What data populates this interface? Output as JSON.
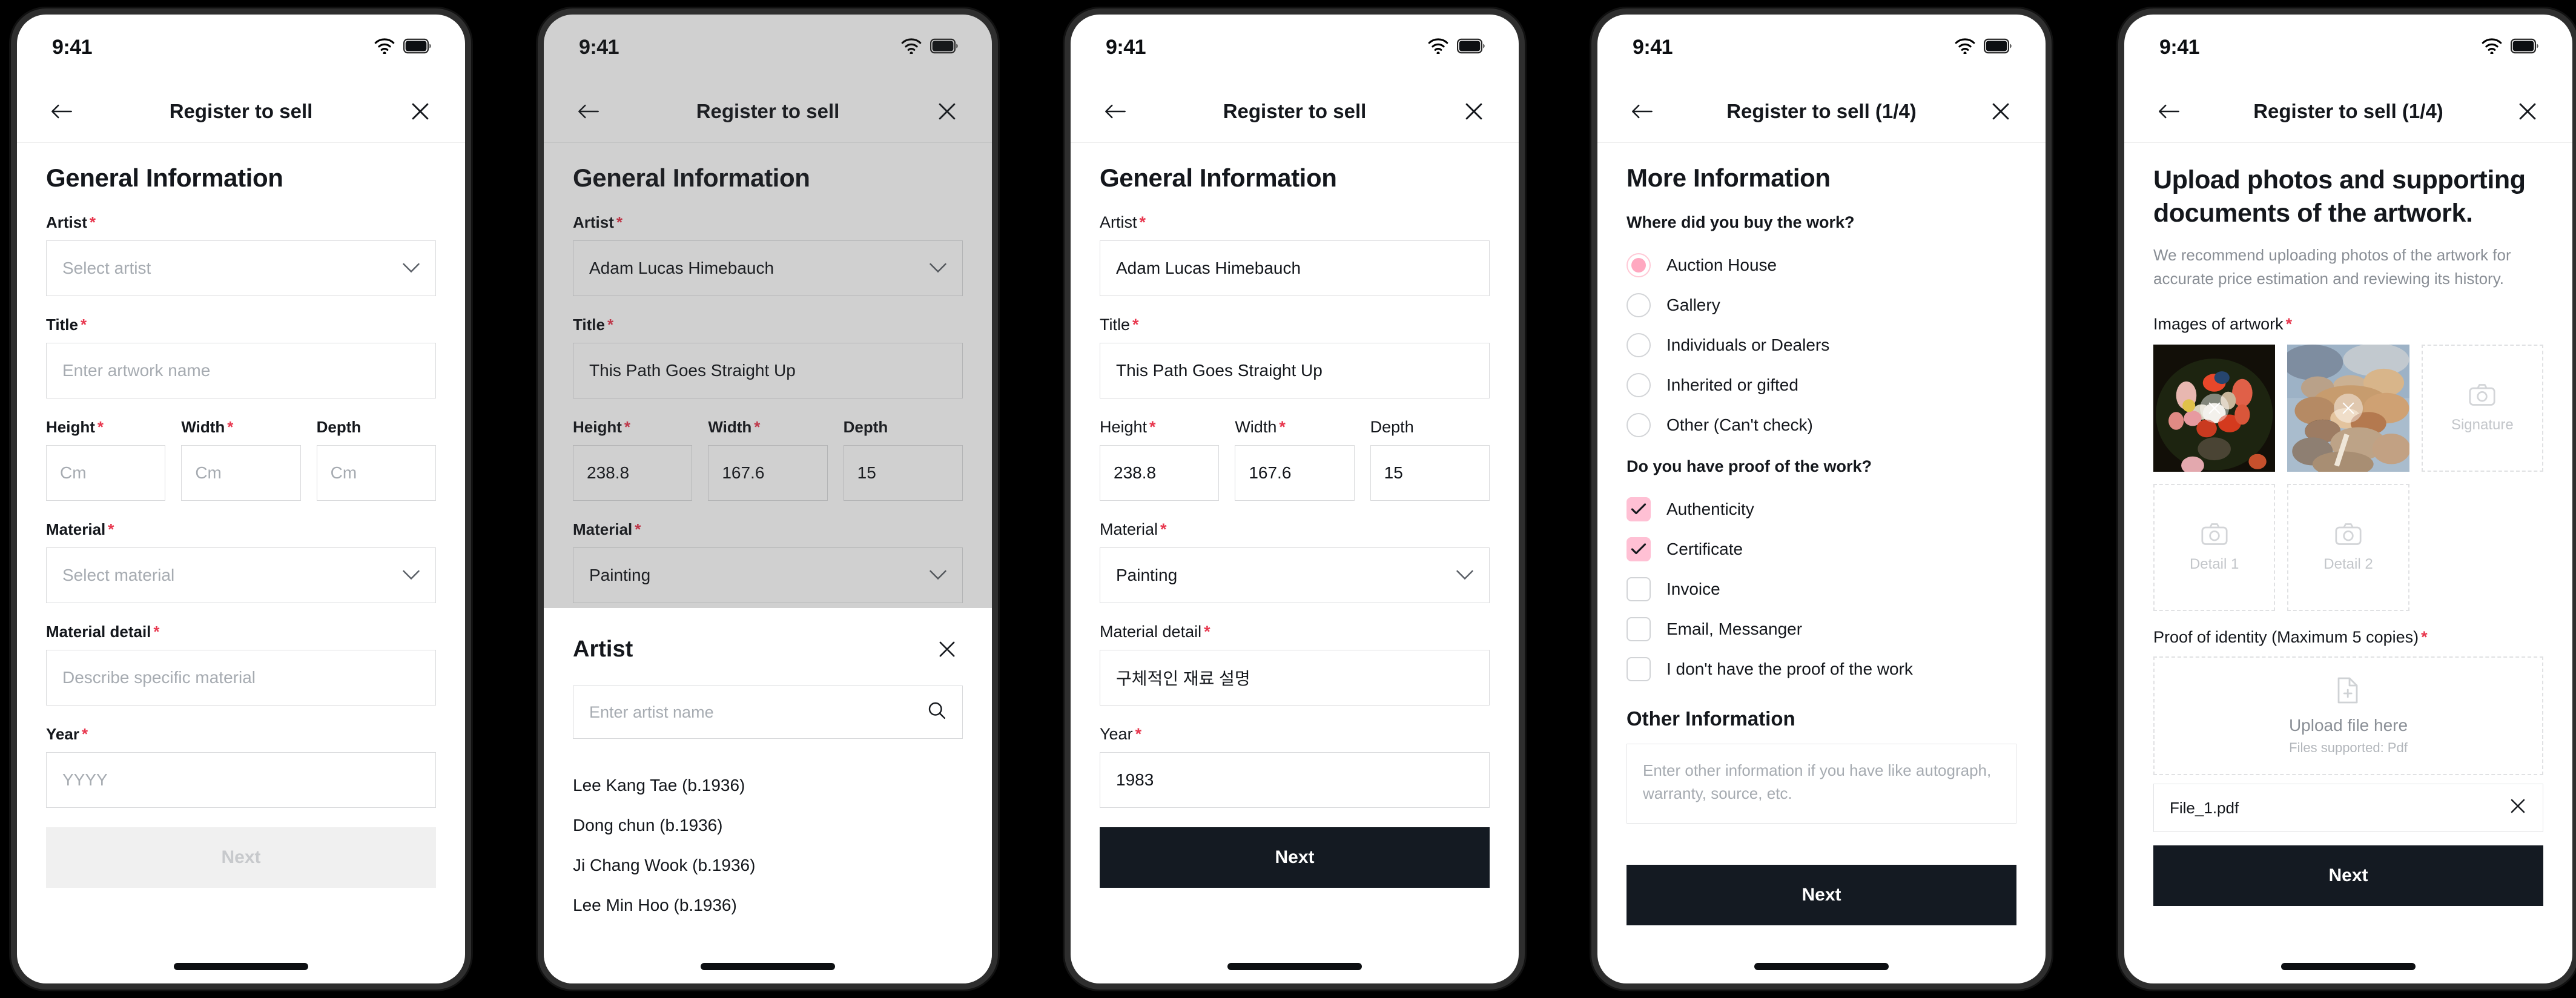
{
  "status": {
    "time": "9:41",
    "wifi_icon": "wifi-icon",
    "battery_icon": "battery-icon"
  },
  "nav": {
    "title_plain": "Register to sell",
    "title_step": "Register to sell (1/4)",
    "back_icon": "arrow-left-icon",
    "close_icon": "close-icon"
  },
  "screen1": {
    "page_title": "General Information",
    "fields": {
      "artist_label": "Artist",
      "artist_placeholder": "Select artist",
      "title_label": "Title",
      "title_placeholder": "Enter artwork name",
      "height_label": "Height",
      "height_placeholder": "Cm",
      "width_label": "Width",
      "width_placeholder": "Cm",
      "depth_label": "Depth",
      "depth_placeholder": "Cm",
      "material_label": "Material",
      "material_placeholder": "Select material",
      "material_detail_label": "Material detail",
      "material_detail_placeholder": "Describe specific material",
      "year_label": "Year",
      "year_placeholder": "YYYY"
    },
    "next_label": "Next"
  },
  "screen2": {
    "page_title": "General Information",
    "values": {
      "artist": "Adam Lucas Himebauch",
      "title": "This Path Goes Straight Up",
      "height": "238.8",
      "width": "167.6",
      "depth": "15",
      "material": "Painting"
    },
    "sheet": {
      "title": "Artist",
      "close_icon": "close-icon",
      "search_placeholder": "Enter artist name",
      "search_icon": "search-icon",
      "items": [
        "Lee Kang Tae (b.1936)",
        "Dong chun (b.1936)",
        "Ji Chang Wook (b.1936)",
        "Lee Min Hoo (b.1936)"
      ]
    }
  },
  "screen3": {
    "page_title": "General Information",
    "values": {
      "artist": "Adam Lucas Himebauch",
      "title": "This Path Goes Straight Up",
      "height": "238.8",
      "width": "167.6",
      "depth": "15",
      "material": "Painting",
      "material_detail": "구체적인 재료 설명",
      "year": "1983"
    },
    "next_label": "Next"
  },
  "screen4": {
    "page_title": "More Information",
    "question_where": "Where did you buy the work?",
    "where_options": [
      {
        "label": "Auction House",
        "selected": true
      },
      {
        "label": "Gallery",
        "selected": false
      },
      {
        "label": "Individuals or Dealers",
        "selected": false
      },
      {
        "label": "Inherited or gifted",
        "selected": false
      },
      {
        "label": "Other (Can't check)",
        "selected": false
      }
    ],
    "question_proof": "Do you have proof of the work?",
    "proof_options": [
      {
        "label": "Authenticity",
        "checked": true
      },
      {
        "label": "Certificate",
        "checked": true
      },
      {
        "label": "Invoice",
        "checked": false
      },
      {
        "label": "Email, Messanger",
        "checked": false
      },
      {
        "label": "I don't have the proof of the work",
        "checked": false
      }
    ],
    "other_heading": "Other Information",
    "other_placeholder": "Enter other information if you have like autograph, warranty, source, etc.",
    "next_label": "Next"
  },
  "screen5": {
    "page_title": "Upload photos and supporting documents of the artwork.",
    "page_sub": "We recommend uploading photos of the artwork for accurate price estimation and reviewing its history.",
    "images_label": "Images of artwork",
    "thumbs": [
      {
        "name": "artwork-photo-1",
        "remove_icon": "close-icon"
      },
      {
        "name": "artwork-photo-2",
        "remove_icon": "close-icon"
      }
    ],
    "slots": [
      {
        "label": "Signature",
        "icon": "camera-icon"
      },
      {
        "label": "Detail 1",
        "icon": "camera-icon"
      },
      {
        "label": "Detail 2",
        "icon": "camera-icon"
      }
    ],
    "proof_label": "Proof of identity (Maximum 5 copies)",
    "dropzone_icon": "file-plus-icon",
    "dropzone_main": "Upload file here",
    "dropzone_sub": "Files supported: Pdf",
    "file_name": "File_1.pdf",
    "file_remove_icon": "close-icon",
    "next_label": "Next"
  },
  "colors": {
    "accent_pink": "#ffc0d4",
    "required_red": "#e8384f",
    "primary_dark": "#141a22"
  }
}
